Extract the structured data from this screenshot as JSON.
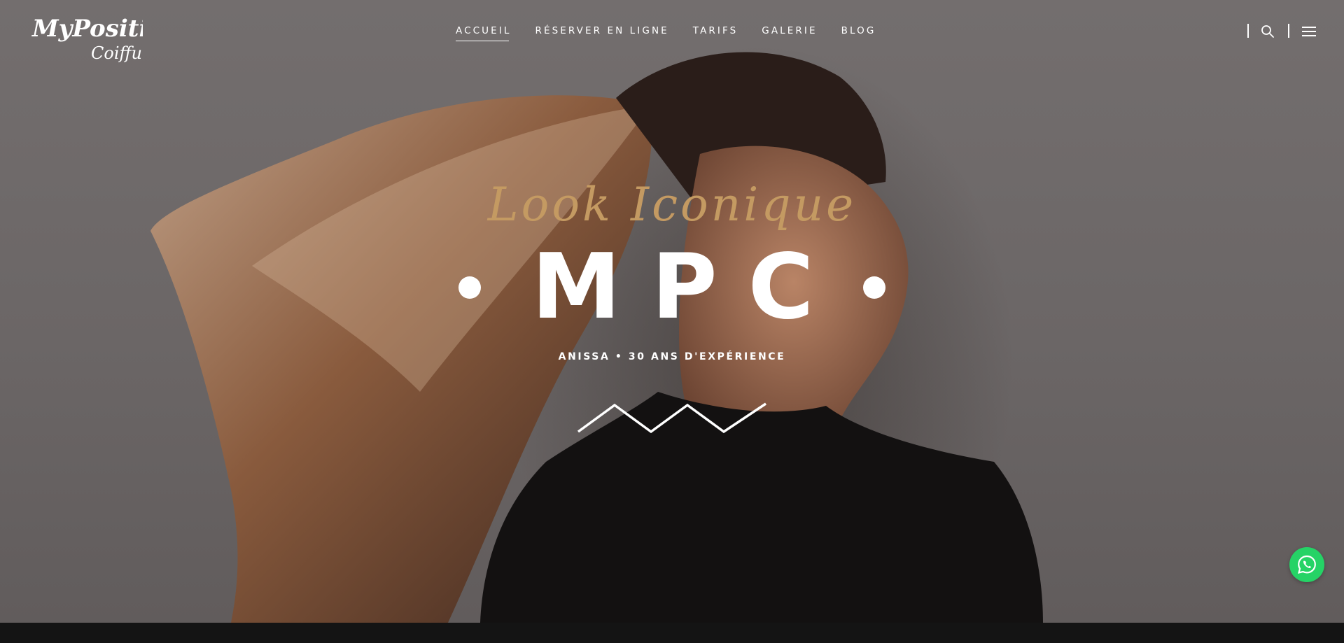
{
  "header": {
    "logo_text": "MyPositif Coiffure",
    "nav": [
      {
        "label": "ACCUEIL",
        "active": true
      },
      {
        "label": "RÉSERVER EN LIGNE",
        "active": false
      },
      {
        "label": "TARIFS",
        "active": false
      },
      {
        "label": "GALERIE",
        "active": false
      },
      {
        "label": "BLOG",
        "active": false
      }
    ],
    "icons": [
      "search-icon",
      "hamburger-menu-icon"
    ]
  },
  "hero": {
    "script_title": "Look Iconique",
    "brand": "MPC",
    "tagline": "ANISSA • 30 ANS D'EXPÉRIENCE",
    "decoration": "zigzag-divider"
  },
  "floating": {
    "icon": "whatsapp-icon",
    "color": "#25d366"
  },
  "colors": {
    "accent_gold": "#c49a62",
    "text": "#ffffff",
    "background": "#6f6a6a",
    "footer_bar": "#141414"
  }
}
